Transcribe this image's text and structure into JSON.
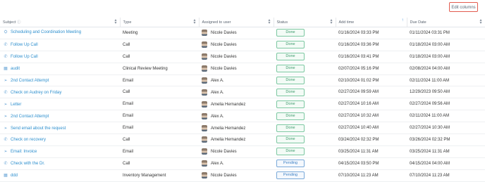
{
  "toolbar": {
    "edit_columns_label": "Edit columns"
  },
  "columns": [
    {
      "label": "Subject"
    },
    {
      "label": "Type"
    },
    {
      "label": "Assigned to user"
    },
    {
      "label": "Status"
    },
    {
      "label": "Add time"
    },
    {
      "label": "Due Date"
    }
  ],
  "rows": [
    {
      "icon": "people-icon",
      "subject": "Scheduling and Coordination Meeting",
      "type": "Meeting",
      "user": "Nicole Davies",
      "status": "Done",
      "add_time": "01/16/2024 03:33 PM",
      "due_date": "01/11/2024 03:31 PM"
    },
    {
      "icon": "phone-icon",
      "subject": "Follow Up Call",
      "type": "Call",
      "user": "Nicole Davies",
      "status": "Done",
      "add_time": "01/16/2024 03:36 PM",
      "due_date": "01/18/2024 03:00 AM"
    },
    {
      "icon": "phone-icon",
      "subject": "Follow Up Call",
      "type": "Call",
      "user": "Nicole Davies",
      "status": "Done",
      "add_time": "01/16/2024 03:41 PM",
      "due_date": "01/18/2024 03:00 AM"
    },
    {
      "icon": "calendar-icon",
      "subject": "audit",
      "type": "Clinical Review Meeting",
      "user": "Nicole Davies",
      "status": "Done",
      "add_time": "02/07/2024 05:16 PM",
      "due_date": "02/08/2024 04:00 AM"
    },
    {
      "icon": "send-icon",
      "subject": "2nd Contact Attempt",
      "type": "Email",
      "user": "Alex A.",
      "status": "Done",
      "add_time": "02/10/2024 01:02 PM",
      "due_date": "02/11/2024 11:00 AM"
    },
    {
      "icon": "phone-icon",
      "subject": "Check on Audrey on Friday",
      "type": "Call",
      "user": "Alex A.",
      "status": "Done",
      "add_time": "02/27/2024 09:59 AM",
      "due_date": "12/29/2023 09:50 AM"
    },
    {
      "icon": "send-icon",
      "subject": "Letter",
      "type": "Email",
      "user": "Amelia Hernandez",
      "status": "Done",
      "add_time": "02/27/2024 10:16 AM",
      "due_date": "02/27/2024 09:56 AM"
    },
    {
      "icon": "send-icon",
      "subject": "2nd Contact Attempt",
      "type": "Email",
      "user": "Alex A.",
      "status": "Done",
      "add_time": "02/27/2024 10:32 AM",
      "due_date": "02/11/2024 11:00 AM"
    },
    {
      "icon": "send-icon",
      "subject": "Send email about the request",
      "type": "Email",
      "user": "Amelia Hernandez",
      "status": "Done",
      "add_time": "02/27/2024 10:40 AM",
      "due_date": "02/27/2024 10:30 AM"
    },
    {
      "icon": "phone-icon",
      "subject": "Check on recovery",
      "type": "Call",
      "user": "Amelia Hernandez",
      "status": "Done",
      "add_time": "03/24/2024 02:32 PM",
      "due_date": "03/26/2024 02:32 PM"
    },
    {
      "icon": "send-icon",
      "subject": "Email: Invoice",
      "type": "Email",
      "user": "Nicole Davies",
      "status": "Done",
      "add_time": "03/25/2024 11:31 AM",
      "due_date": "03/25/2024 11:31 AM"
    },
    {
      "icon": "phone-icon",
      "subject": "Check with the Dr.",
      "type": "Call",
      "user": "Alex A.",
      "status": "Pending",
      "add_time": "04/15/2024 03:50 PM",
      "due_date": "04/15/2024 04:00 AM"
    },
    {
      "icon": "calendar-icon",
      "subject": "ddd",
      "type": "Inventory Management",
      "user": "Nicole Davies",
      "status": "Pending",
      "add_time": "07/10/2024 11:23 AM",
      "due_date": "07/10/2024 11:23 AM"
    }
  ]
}
